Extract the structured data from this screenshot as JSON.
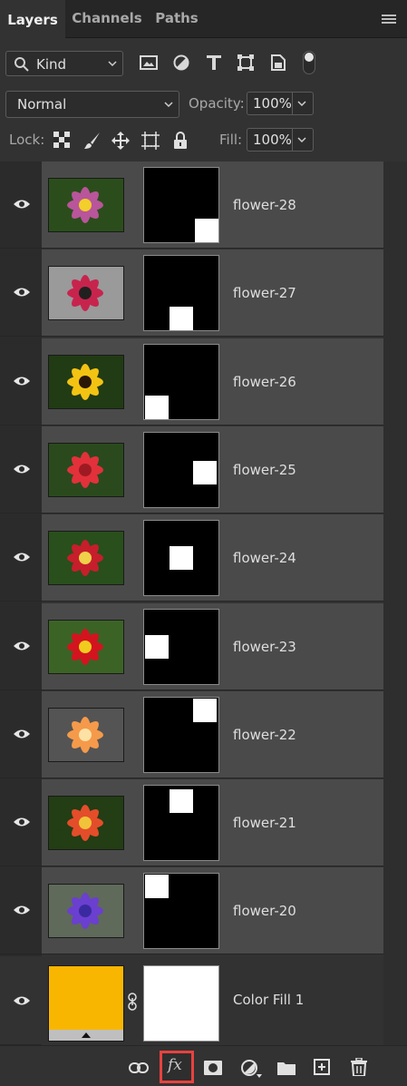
{
  "tabs": [
    {
      "label": "Layers",
      "active": true
    },
    {
      "label": "Channels",
      "active": false
    },
    {
      "label": "Paths",
      "active": false
    }
  ],
  "filter": {
    "kind_label": "Kind"
  },
  "blend": {
    "mode": "Normal",
    "opacity_label": "Opacity:",
    "opacity_value": "100%"
  },
  "lock": {
    "label": "Lock:",
    "fill_label": "Fill:",
    "fill_value": "100%"
  },
  "layers": [
    {
      "name": "flower-28",
      "thumb_colors": [
        "#2b4d1c",
        "#b9559a",
        "#f2cf2a"
      ],
      "mask_square": "bottom-right"
    },
    {
      "name": "flower-27",
      "thumb_colors": [
        "#9a9a9a",
        "#c7244d",
        "#202020"
      ],
      "mask_square": "bottom-center"
    },
    {
      "name": "flower-26",
      "thumb_colors": [
        "#213b14",
        "#f3c313",
        "#2a1706"
      ],
      "mask_square": "bottom-left"
    },
    {
      "name": "flower-25",
      "thumb_colors": [
        "#2a4a1d",
        "#e2313a",
        "#9e1a23"
      ],
      "mask_square": "middle-right"
    },
    {
      "name": "flower-24",
      "thumb_colors": [
        "#294f1c",
        "#c71e2b",
        "#f0d24a"
      ],
      "mask_square": "center"
    },
    {
      "name": "flower-23",
      "thumb_colors": [
        "#3c6326",
        "#d3141f",
        "#f1cc1e"
      ],
      "mask_square": "middle-left"
    },
    {
      "name": "flower-22",
      "thumb_colors": [
        "#545454",
        "#f59a4a",
        "#fde2a5"
      ],
      "mask_square": "top-right"
    },
    {
      "name": "flower-21",
      "thumb_colors": [
        "#233d14",
        "#e44d2a",
        "#f0c33a"
      ],
      "mask_square": "top-center"
    },
    {
      "name": "flower-20",
      "thumb_colors": [
        "#5f6a5a",
        "#6b3fcf",
        "#3a2aa0"
      ],
      "mask_square": "top-left"
    }
  ],
  "fill_layer": {
    "name": "Color Fill 1",
    "color": "#f9b600"
  },
  "icons": {
    "tab_menu": "hamburger-icon",
    "filter": [
      "image-filter-icon",
      "adjustment-filter-icon",
      "type-filter-icon",
      "shape-filter-icon",
      "smart-object-filter-icon"
    ],
    "lock": [
      "lock-transparent-icon",
      "lock-image-icon",
      "lock-position-icon",
      "lock-artboard-icon",
      "lock-all-icon"
    ],
    "bottom": [
      "link-layers-icon",
      "fx-icon",
      "add-mask-icon",
      "adjustment-layer-icon",
      "new-group-icon",
      "new-layer-icon",
      "delete-icon"
    ]
  }
}
